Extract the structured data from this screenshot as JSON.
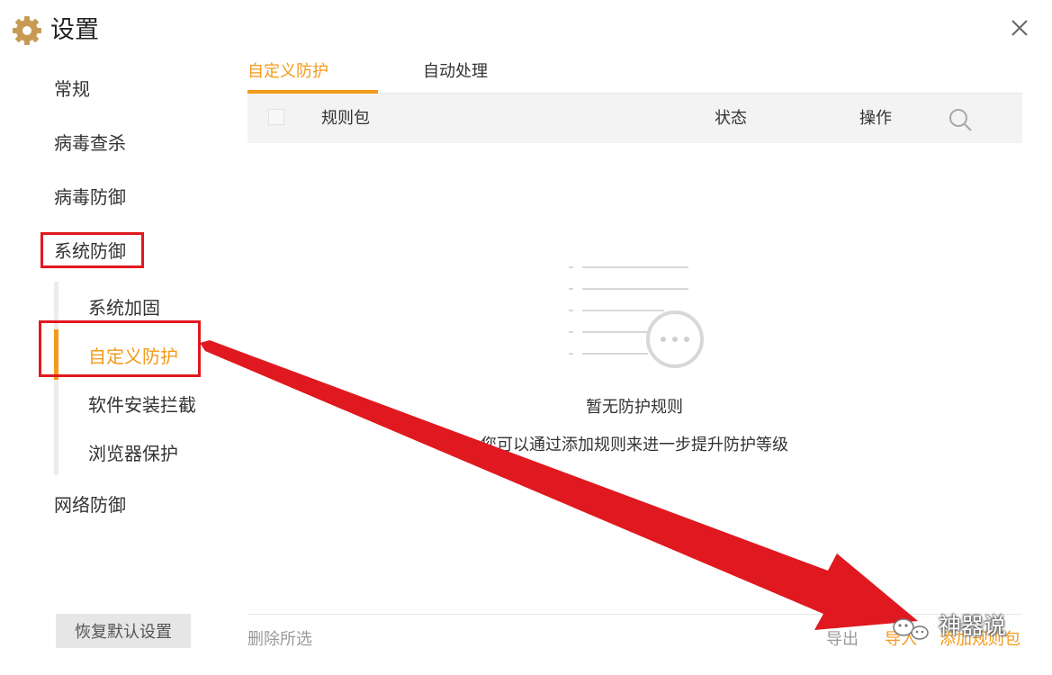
{
  "window": {
    "title": "设置",
    "icons": {
      "settings": "gear-icon",
      "close": "close-icon"
    }
  },
  "sidebar": {
    "items": [
      {
        "label": "常规"
      },
      {
        "label": "病毒查杀"
      },
      {
        "label": "病毒防御"
      },
      {
        "label": "系统防御"
      },
      {
        "label": "网络防御"
      }
    ],
    "sub_items": [
      {
        "label": "系统加固"
      },
      {
        "label": "自定义防护",
        "active": true
      },
      {
        "label": "软件安装拦截"
      },
      {
        "label": "浏览器保护"
      }
    ],
    "restore_button": "恢复默认设置"
  },
  "tabs": [
    {
      "label": "自定义防护",
      "active": true
    },
    {
      "label": "自动处理"
    }
  ],
  "table": {
    "columns": {
      "name": "规则包",
      "status": "状态",
      "action": "操作"
    },
    "search_icon": "search-icon"
  },
  "empty": {
    "title": "暂无防护规则",
    "subtitle": "您可以通过添加规则来进一步提升防护等级"
  },
  "footer": {
    "delete_selected": "删除所选",
    "export": "导出",
    "import": "导入",
    "add_rule_pack": "添加规则包"
  },
  "watermark": {
    "text": "神器说"
  },
  "colors": {
    "accent": "#f39a1b",
    "annotation": "#e0181f",
    "header_bg": "#f3f3f3"
  }
}
